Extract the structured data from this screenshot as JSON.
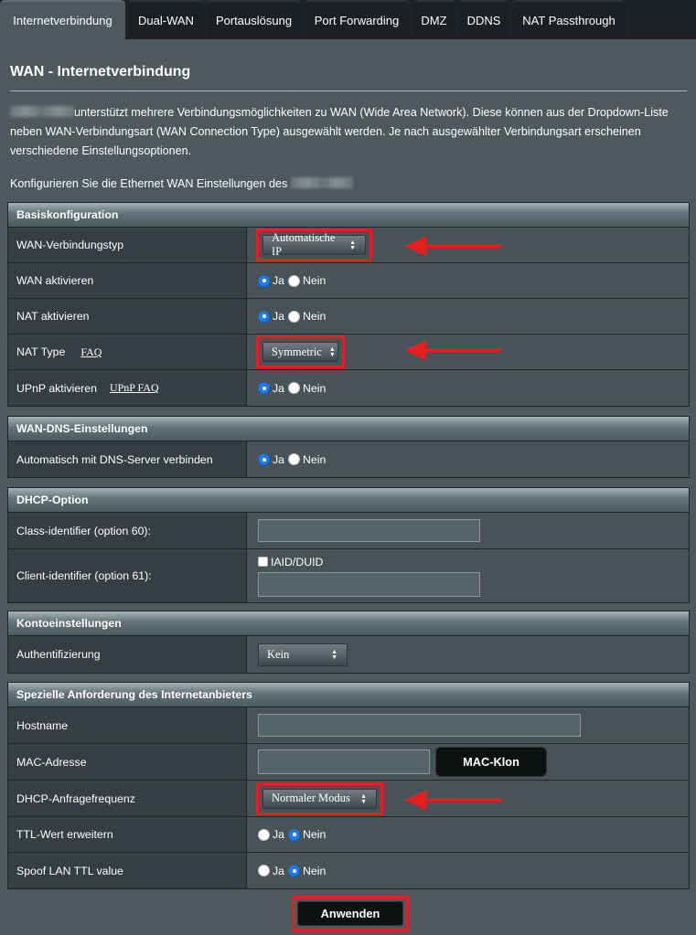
{
  "tabs": [
    {
      "label": "Internetverbindung",
      "active": true
    },
    {
      "label": "Dual-WAN",
      "active": false
    },
    {
      "label": "Portauslösung",
      "active": false
    },
    {
      "label": "Port Forwarding",
      "active": false
    },
    {
      "label": "DMZ",
      "active": false
    },
    {
      "label": "DDNS",
      "active": false
    },
    {
      "label": "NAT Passthrough",
      "active": false
    }
  ],
  "page": {
    "title": "WAN - Internetverbindung",
    "description": "unterstützt mehrere Verbindungsmöglichkeiten zu WAN (Wide Area Network). Diese können aus der Dropdown-Liste neben WAN-Verbindungsart (WAN Connection Type) ausgewählt werden. Je nach ausgewählter Verbindungsart erscheinen verschiedene Einstellungsoptionen.",
    "configure_text": "Konfigurieren Sie die Ethernet WAN Einstellungen des"
  },
  "basis": {
    "header": "Basiskonfiguration",
    "wan_type_label": "WAN-Verbindungstyp",
    "wan_type_value": "Automatische IP",
    "wan_enable_label": "WAN aktivieren",
    "nat_enable_label": "NAT aktivieren",
    "nat_type_label": "NAT Type",
    "nat_type_faq": "FAQ",
    "nat_type_value": "Symmetric",
    "upnp_label": "UPnP aktivieren",
    "upnp_faq": "UPnP FAQ"
  },
  "radio": {
    "yes": "Ja",
    "no": "Nein"
  },
  "dns": {
    "header": "WAN-DNS-Einstellungen",
    "auto_dns_label": "Automatisch mit DNS-Server verbinden"
  },
  "dhcp": {
    "header": "DHCP-Option",
    "class_id_label": "Class-identifier (option 60):",
    "class_id_value": "",
    "client_id_label": "Client-identifier (option 61):",
    "iaid_label": "IAID/DUID",
    "client_id_value": ""
  },
  "account": {
    "header": "Kontoeinstellungen",
    "auth_label": "Authentifizierung",
    "auth_value": "Kein"
  },
  "isp": {
    "header": "Spezielle Anforderung des Internetanbieters",
    "hostname_label": "Hostname",
    "hostname_value": "",
    "mac_label": "MAC-Adresse",
    "mac_value": "",
    "mac_clone_button": "MAC-Klon",
    "dhcp_freq_label": "DHCP-Anfragefrequenz",
    "dhcp_freq_value": "Normaler Modus",
    "ttl_label": "TTL-Wert erweitern",
    "spoof_ttl_label": "Spoof LAN TTL value"
  },
  "apply_button": "Anwenden",
  "colors": {
    "annotation_red": "#e51f1f",
    "radio_checked": "#1c7cf0"
  }
}
